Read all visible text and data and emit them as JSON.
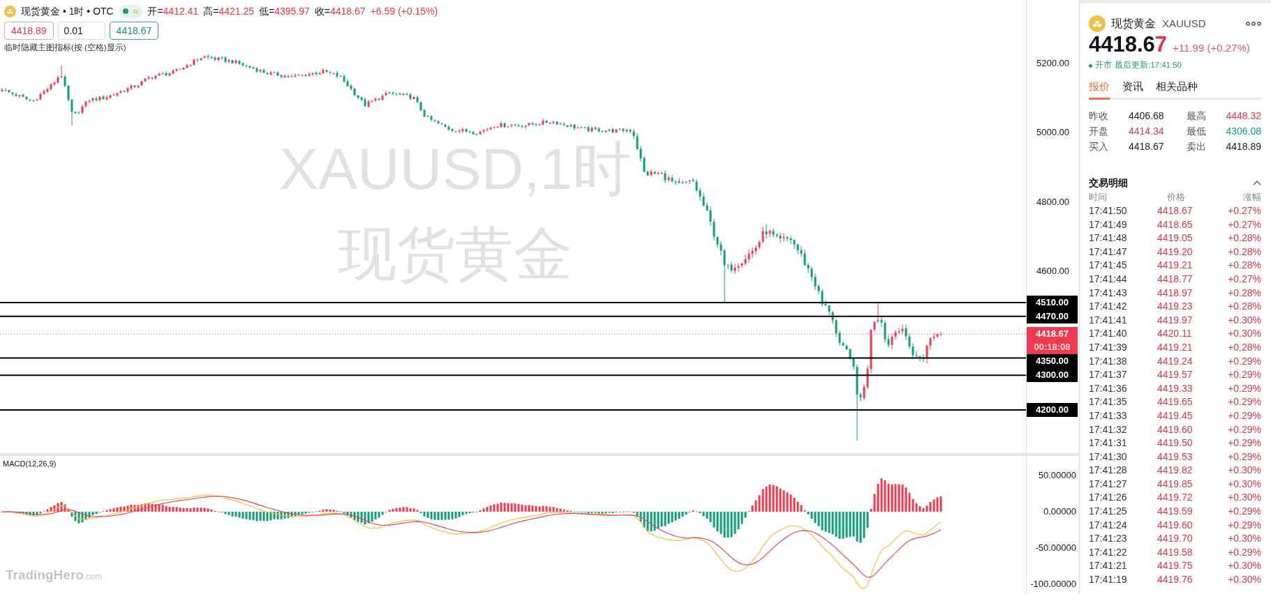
{
  "legend": {
    "title": "现货黄金 • 1时 • OTC",
    "badge_symbol": "≈",
    "ohlc": [
      {
        "label": "开=",
        "value": "4412.41"
      },
      {
        "label": "高=",
        "value": "4421.25"
      },
      {
        "label": "低=",
        "value": "4395.97"
      },
      {
        "label": "收=",
        "value": "4418.67"
      }
    ],
    "change": "+6.59 (+0.15%)"
  },
  "order_bar": {
    "sell_price": "4418.89",
    "quantity": "0.01",
    "buy_price": "4418.67"
  },
  "indicator_hint": "临时隐藏主图指标(按 (空格)显示)",
  "chart_background_label": [
    "XAUUSD,1时",
    "现货黄金"
  ],
  "price_axis": {
    "ticks": [
      "5200.00",
      "5000.00",
      "4800.00",
      "4600.00"
    ]
  },
  "price_levels": [
    {
      "label": "4510.00"
    },
    {
      "label": "4470.00"
    },
    {
      "label": "4350.00"
    },
    {
      "label": "4300.00"
    },
    {
      "label": "4200.00"
    }
  ],
  "current_price": {
    "label": "4418.67",
    "countdown": "00:18:08"
  },
  "macd": {
    "title": "MACD(12,26,9)",
    "ticks": [
      "50.00000",
      "0.00000",
      "-50.00000",
      "-100.00000"
    ]
  },
  "branding": {
    "name": "TradingHero",
    "suffix": ".com"
  },
  "quote_panel": {
    "name": "现货黄金",
    "code": "XAUUSD",
    "price_lead": "4418.6",
    "price_changed_digits": "7",
    "change": "+11.99 (+0.27%)",
    "market_status": "开市",
    "last_update": "最后更新:17:41:50",
    "tabs": [
      {
        "label": "报价",
        "selected": true
      },
      {
        "label": "资讯",
        "selected": false
      },
      {
        "label": "相关品种",
        "selected": false
      }
    ],
    "stats": [
      {
        "label": "昨收",
        "value": "4406.68",
        "color": "#222222"
      },
      {
        "label": "最高",
        "value": "4448.32",
        "color": "#e8334a"
      },
      {
        "label": "开盘",
        "value": "4414.34",
        "color": "#e8334a"
      },
      {
        "label": "最低",
        "value": "4306.08",
        "color": "#119b7d"
      },
      {
        "label": "买入",
        "value": "4418.67",
        "color": "#222222"
      },
      {
        "label": "卖出",
        "value": "4418.89",
        "color": "#222222"
      }
    ],
    "trades": {
      "title": "交易明细",
      "expanded": true,
      "columns": [
        "时间",
        "价格",
        "涨幅"
      ],
      "rows": [
        {
          "time": "17:41:50",
          "price": "4418.67",
          "change": "+0.27%"
        },
        {
          "time": "17:41:49",
          "price": "4418.65",
          "change": "+0.27%"
        },
        {
          "time": "17:41:48",
          "price": "4419.05",
          "change": "+0.28%"
        },
        {
          "time": "17:41:47",
          "price": "4419.20",
          "change": "+0.28%"
        },
        {
          "time": "17:41:45",
          "price": "4419.21",
          "change": "+0.28%"
        },
        {
          "time": "17:41:44",
          "price": "4418.77",
          "change": "+0.27%"
        },
        {
          "time": "17:41:43",
          "price": "4418.97",
          "change": "+0.28%"
        },
        {
          "time": "17:41:42",
          "price": "4419.23",
          "change": "+0.28%"
        },
        {
          "time": "17:41:41",
          "price": "4419.97",
          "change": "+0.30%"
        },
        {
          "time": "17:41:40",
          "price": "4420.11",
          "change": "+0.30%"
        },
        {
          "time": "17:41:39",
          "price": "4419.21",
          "change": "+0.28%"
        },
        {
          "time": "17:41:38",
          "price": "4419.24",
          "change": "+0.29%"
        },
        {
          "time": "17:41:37",
          "price": "4419.57",
          "change": "+0.29%"
        },
        {
          "time": "17:41:36",
          "price": "4419.33",
          "change": "+0.29%"
        },
        {
          "time": "17:41:35",
          "price": "4419.65",
          "change": "+0.29%"
        },
        {
          "time": "17:41:33",
          "price": "4419.45",
          "change": "+0.29%"
        },
        {
          "time": "17:41:32",
          "price": "4419.60",
          "change": "+0.29%"
        },
        {
          "time": "17:41:31",
          "price": "4419.50",
          "change": "+0.29%"
        },
        {
          "time": "17:41:30",
          "price": "4419.53",
          "change": "+0.29%"
        },
        {
          "time": "17:41:28",
          "price": "4419.82",
          "change": "+0.30%"
        },
        {
          "time": "17:41:27",
          "price": "4419.85",
          "change": "+0.30%"
        },
        {
          "time": "17:41:26",
          "price": "4419.72",
          "change": "+0.30%"
        },
        {
          "time": "17:41:25",
          "price": "4419.59",
          "change": "+0.29%"
        },
        {
          "time": "17:41:24",
          "price": "4419.60",
          "change": "+0.29%"
        },
        {
          "time": "17:41:23",
          "price": "4419.70",
          "change": "+0.30%"
        },
        {
          "time": "17:41:22",
          "price": "4419.58",
          "change": "+0.29%"
        },
        {
          "time": "17:41:21",
          "price": "4419.75",
          "change": "+0.30%"
        },
        {
          "time": "17:41:19",
          "price": "4419.76",
          "change": "+0.30%"
        }
      ]
    }
  }
}
